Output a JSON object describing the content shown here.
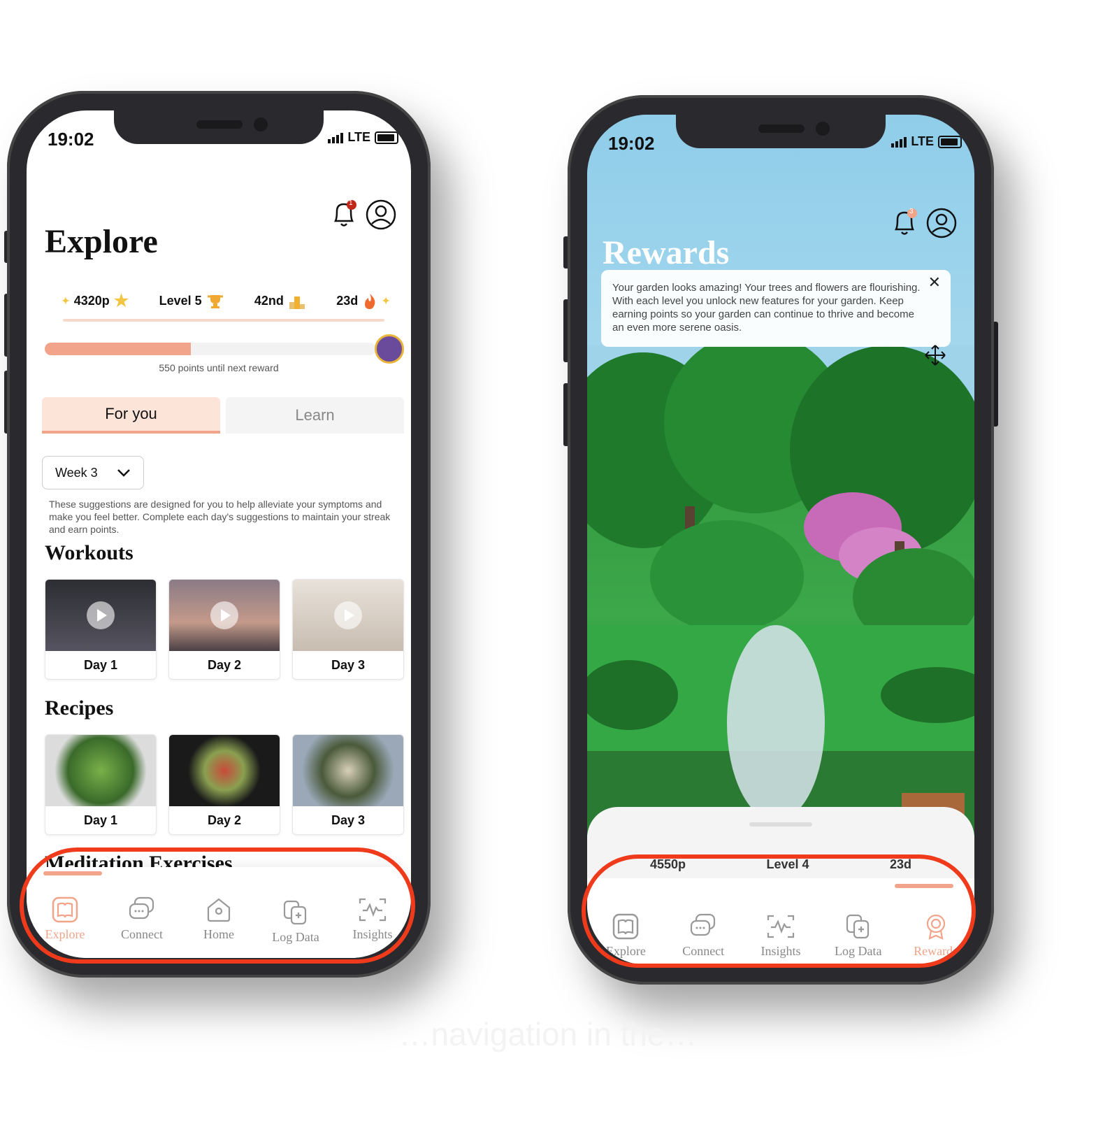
{
  "left_phone": {
    "status": {
      "time": "19:02",
      "network": "LTE"
    },
    "notification_count": "1",
    "title": "Explore",
    "stats": {
      "points": "4320p",
      "level": "Level 5",
      "rank": "42nd",
      "streak": "23d"
    },
    "progress": {
      "value_fraction": 0.44,
      "label": "550 points until next reward"
    },
    "tabs": [
      {
        "label": "For you",
        "active": true
      },
      {
        "label": "Learn",
        "active": false
      }
    ],
    "week_select": "Week 3",
    "description": "These suggestions are designed for you to help alleviate your symptoms and make you feel better. Complete each day's suggestions to maintain your streak and earn points.",
    "sections": {
      "workouts": {
        "title": "Workouts",
        "cards": [
          "Day 1",
          "Day 2",
          "Day 3"
        ]
      },
      "recipes": {
        "title": "Recipes",
        "cards": [
          "Day 1",
          "Day 2",
          "Day 3"
        ]
      },
      "meditation": {
        "title": "Meditation Exercises"
      }
    },
    "nav": [
      {
        "label": "Explore",
        "icon": "book-icon",
        "active": true
      },
      {
        "label": "Connect",
        "icon": "chat-icon",
        "active": false
      },
      {
        "label": "Home",
        "icon": "home-icon",
        "active": false
      },
      {
        "label": "Log Data",
        "icon": "log-data-icon",
        "active": false
      },
      {
        "label": "Insights",
        "icon": "insights-icon",
        "active": false
      }
    ]
  },
  "right_phone": {
    "status": {
      "time": "19:02",
      "network": "LTE"
    },
    "notification_count": "3",
    "title": "Rewards",
    "popup_text": "Your garden looks amazing! Your trees and flowers are flourishing. With each level you unlock new features for your garden. Keep earning points so your garden can continue to thrive and become an even more serene oasis.",
    "popup_close": "✕",
    "sheet_stats": {
      "points": "4550p",
      "level": "Level 4",
      "streak": "23d"
    },
    "nav": [
      {
        "label": "Explore",
        "icon": "book-icon",
        "active": false
      },
      {
        "label": "Connect",
        "icon": "chat-icon",
        "active": false
      },
      {
        "label": "Insights",
        "icon": "insights-icon",
        "active": false
      },
      {
        "label": "Log Data",
        "icon": "log-data-icon",
        "active": false
      },
      {
        "label": "Rewards",
        "icon": "rewards-icon",
        "active": true
      }
    ]
  },
  "caption": "…navigation in the…",
  "colors": {
    "accent": "#f2a48a",
    "highlight_oval": "#f03a1c",
    "sky": "#8fcde9"
  }
}
